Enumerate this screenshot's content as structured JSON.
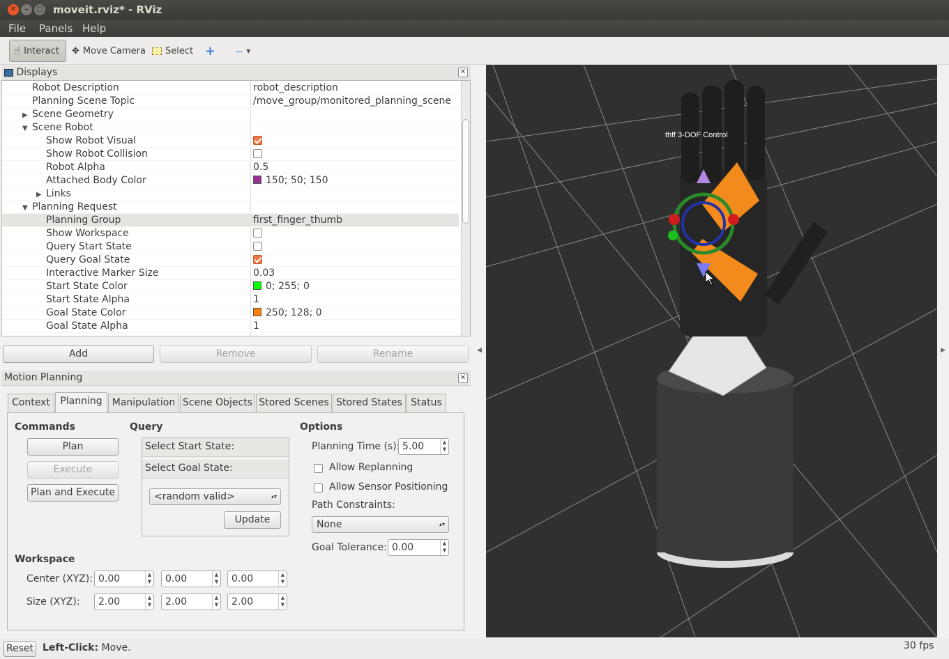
{
  "window": {
    "title": "moveit.rviz* - RViz"
  },
  "menu": [
    "File",
    "Panels",
    "Help"
  ],
  "toolbar": {
    "interact": "Interact",
    "move_camera": "Move Camera",
    "select": "Select"
  },
  "displays": {
    "title": "Displays",
    "rows": [
      {
        "key": "Robot Description",
        "value": "robot_description"
      },
      {
        "key": "Planning Scene Topic",
        "value": "/move_group/monitored_planning_scene"
      },
      {
        "key": "Scene Geometry",
        "value": ""
      },
      {
        "key": "Scene Robot",
        "value": ""
      },
      {
        "key": "Show Robot Visual",
        "value": ""
      },
      {
        "key": "Show Robot Collision",
        "value": ""
      },
      {
        "key": "Robot Alpha",
        "value": "0.5"
      },
      {
        "key": "Attached Body Color",
        "value": "150; 50; 150"
      },
      {
        "key": "Links",
        "value": ""
      },
      {
        "key": "Planning Request",
        "value": ""
      },
      {
        "key": "Planning Group",
        "value": "first_finger_thumb"
      },
      {
        "key": "Show Workspace",
        "value": ""
      },
      {
        "key": "Query Start State",
        "value": ""
      },
      {
        "key": "Query Goal State",
        "value": ""
      },
      {
        "key": "Interactive Marker Size",
        "value": "0.03"
      },
      {
        "key": "Start State Color",
        "value": "0; 255; 0"
      },
      {
        "key": "Start State Alpha",
        "value": "1"
      },
      {
        "key": "Goal State Color",
        "value": "250; 128; 0"
      },
      {
        "key": "Goal State Alpha",
        "value": "1"
      }
    ],
    "buttons": {
      "add": "Add",
      "remove": "Remove",
      "rename": "Rename"
    },
    "colors": {
      "attached": "#963296",
      "start": "#00ff00",
      "goal": "#fa8000"
    }
  },
  "motion": {
    "title": "Motion Planning",
    "tabs": [
      "Context",
      "Planning",
      "Manipulation",
      "Scene Objects",
      "Stored Scenes",
      "Stored States",
      "Status"
    ],
    "commands": {
      "title": "Commands",
      "plan": "Plan",
      "execute": "Execute",
      "plan_execute": "Plan and Execute"
    },
    "query": {
      "title": "Query",
      "start": "Select Start State:",
      "goal": "Select Goal State:",
      "combo": "<random valid>",
      "update": "Update"
    },
    "options": {
      "title": "Options",
      "planning_time_label": "Planning Time (s):",
      "planning_time": "5.00",
      "replanning": "Allow Replanning",
      "sensor": "Allow Sensor Positioning",
      "path_label": "Path Constraints:",
      "path_value": "None",
      "goal_tol_label": "Goal Tolerance:",
      "goal_tol": "0.00"
    },
    "workspace": {
      "title": "Workspace",
      "center_label": "Center (XYZ):",
      "size_label": "Size (XYZ):",
      "center": [
        "0.00",
        "0.00",
        "0.00"
      ],
      "size": [
        "2.00",
        "2.00",
        "2.00"
      ]
    }
  },
  "viewport": {
    "marker_label": "thff  3-DOF  Control"
  },
  "status": {
    "reset": "Reset",
    "hint_bold": "Left-Click:",
    "hint": "Move.",
    "fps": "30 fps"
  }
}
